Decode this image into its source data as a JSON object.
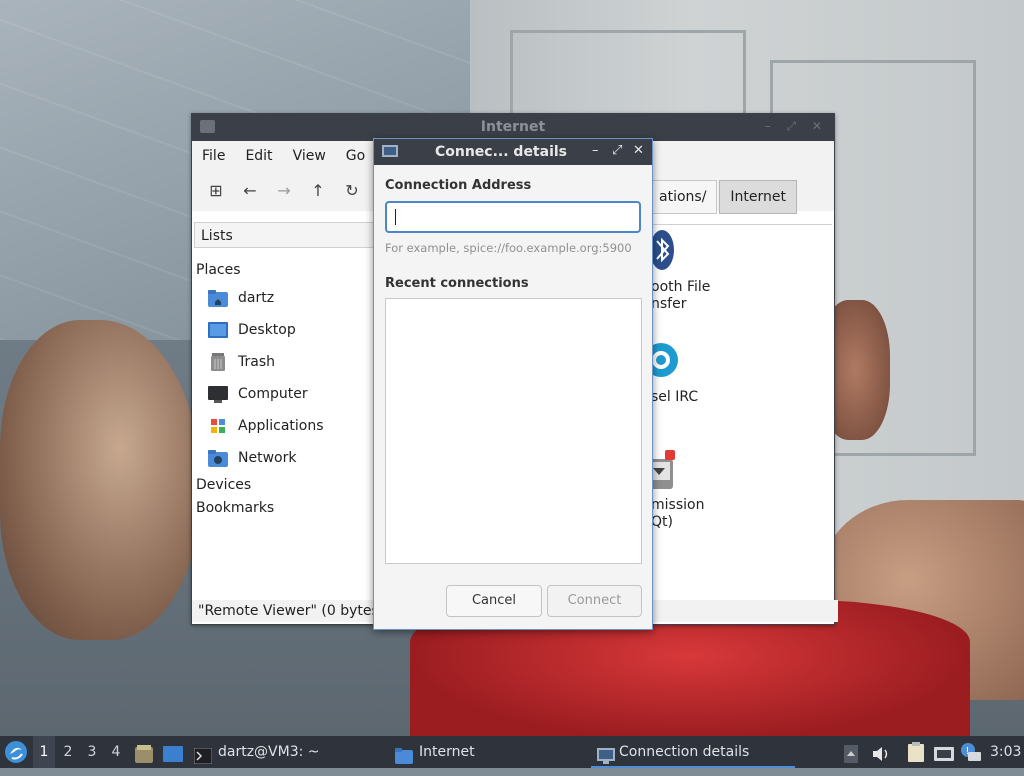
{
  "file_manager": {
    "title": "Internet",
    "menu": [
      "File",
      "Edit",
      "View",
      "Go"
    ],
    "toolbar_icons": [
      "new-tab-icon",
      "back-icon",
      "forward-icon",
      "up-icon",
      "reload-icon"
    ],
    "path_buttons": [
      "ations/",
      "Internet"
    ],
    "side_pane_mode": "Lists",
    "places_heading": "Places",
    "places": [
      {
        "label": "dartz",
        "icon": "home-folder-icon"
      },
      {
        "label": "Desktop",
        "icon": "desktop-icon"
      },
      {
        "label": "Trash",
        "icon": "trash-icon"
      },
      {
        "label": "Computer",
        "icon": "computer-icon"
      },
      {
        "label": "Applications",
        "icon": "applications-icon"
      },
      {
        "label": "Network",
        "icon": "network-icon"
      }
    ],
    "devices_heading": "Devices",
    "bookmarks_heading": "Bookmarks",
    "apps": [
      {
        "line1": "ooth File",
        "line2": "nsfer",
        "icon": "bluetooth-icon"
      },
      {
        "line1": "sel IRC",
        "line2": "",
        "icon": "hexchat-icon"
      },
      {
        "line1": "mission",
        "line2": "Qt)",
        "icon": "transmission-icon"
      }
    ],
    "status": "\"Remote Viewer\" (0 bytes"
  },
  "dialog": {
    "title": "Connec... details",
    "address_label": "Connection Address",
    "address_value": "",
    "hint": "For example, spice://foo.example.org:5900",
    "recent_label": "Recent connections",
    "cancel_label": "Cancel",
    "connect_label": "Connect",
    "window_buttons": [
      "–",
      "⤢",
      "✕"
    ]
  },
  "taskbar": {
    "workspaces": [
      "1",
      "2",
      "3",
      "4"
    ],
    "active_workspace": "1",
    "tasks": [
      {
        "label": "dartz@VM3: ~",
        "icon": "terminal-icon"
      },
      {
        "label": "Internet",
        "icon": "folder-icon"
      },
      {
        "label": "Connection details",
        "icon": "monitor-icon"
      }
    ],
    "clock": "3:03"
  }
}
